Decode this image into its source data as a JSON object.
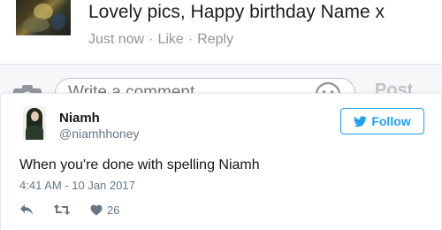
{
  "facebook": {
    "comment_text": "Lovely pics, Happy birthday Name x",
    "time_label": "Just now",
    "like_label": "Like",
    "reply_label": "Reply",
    "separator": "·",
    "compose": {
      "placeholder": "Write a comment...",
      "post_label": "Post"
    }
  },
  "tweet": {
    "display_name": "Niamh",
    "handle": "@niamhhoney",
    "follow_label": "Follow",
    "text": "When you're done with spelling Niamh",
    "timestamp": "4:41 AM - 10 Jan 2017",
    "like_count": "26"
  },
  "colors": {
    "twitter_blue": "#1da1f2",
    "fb_meta_gray": "#90949c",
    "tweet_gray": "#657786"
  },
  "icons": [
    "camera-icon",
    "emoji-icon",
    "twitter-bird-icon",
    "reply-icon",
    "retweet-icon",
    "heart-icon"
  ]
}
